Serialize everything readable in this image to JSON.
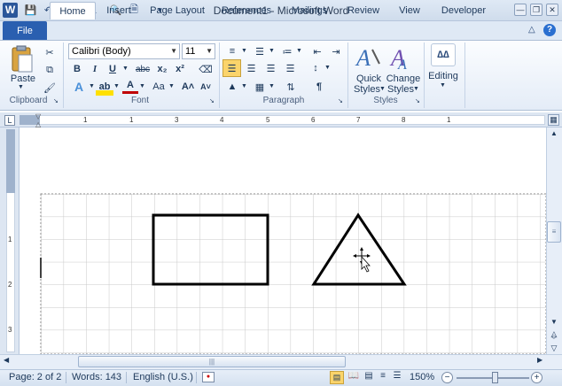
{
  "window": {
    "title": "Document1 - Microsoft Word"
  },
  "tabs": [
    "File",
    "Home",
    "Insert",
    "Page Layout",
    "References",
    "Mailings",
    "Review",
    "View",
    "Developer"
  ],
  "clipboard": {
    "paste": "Paste",
    "label": "Clipboard"
  },
  "font": {
    "name": "Calibri (Body)",
    "size": "11",
    "label": "Font",
    "bold": "B",
    "italic": "I",
    "underline": "U",
    "strike": "abc",
    "sub": "x₂",
    "sup": "x²",
    "grow": "A˄",
    "shrink": "A˅",
    "case": "Aa"
  },
  "paragraph": {
    "label": "Paragraph"
  },
  "styles": {
    "quick": "Quick",
    "quick2": "Styles",
    "change": "Change",
    "change2": "Styles",
    "label": "Styles"
  },
  "editing": {
    "label": "Editing"
  },
  "ruler": {
    "h_numbers": [
      "1",
      "1",
      "2",
      "3",
      "4",
      "5",
      "6",
      "7",
      "8"
    ],
    "v_numbers": [
      "1",
      "2",
      "3"
    ]
  },
  "status": {
    "page": "Page: 2 of 2",
    "words": "Words: 143",
    "language": "English (U.S.)",
    "zoom": "150%"
  },
  "colors": {
    "accent": "#2a5fb0",
    "ribbon_bg": "#e4ecf7",
    "shape_stroke": "#000000",
    "grid": "#c8c8c8"
  }
}
